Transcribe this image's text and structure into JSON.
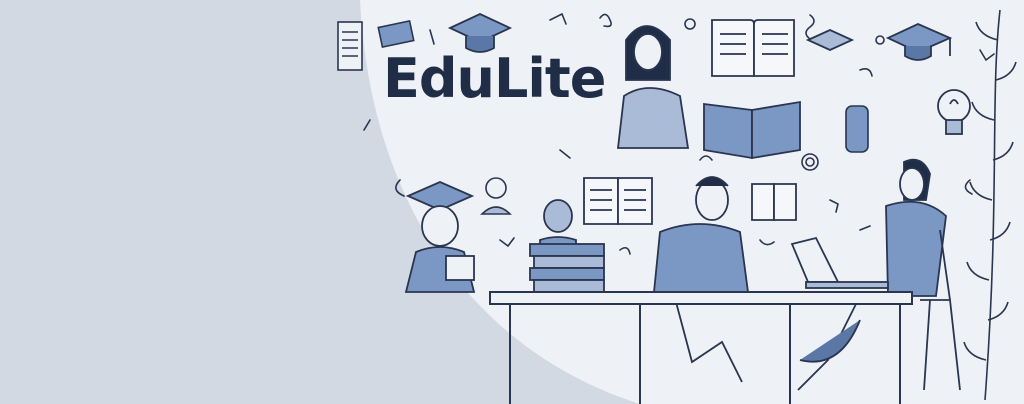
{
  "brand": {
    "name": "EduLite"
  },
  "colors": {
    "background": "#d2d9e3",
    "panel": "#eef1f5",
    "ink": "#1f2d46",
    "accent_blue": "#7b98c4",
    "light_blue": "#a9bbd6"
  },
  "icons": [
    "graduation-cap-icon",
    "open-book-icon",
    "lightbulb-icon",
    "laptop-icon",
    "book-stack-icon",
    "leaf-vine-icon"
  ]
}
